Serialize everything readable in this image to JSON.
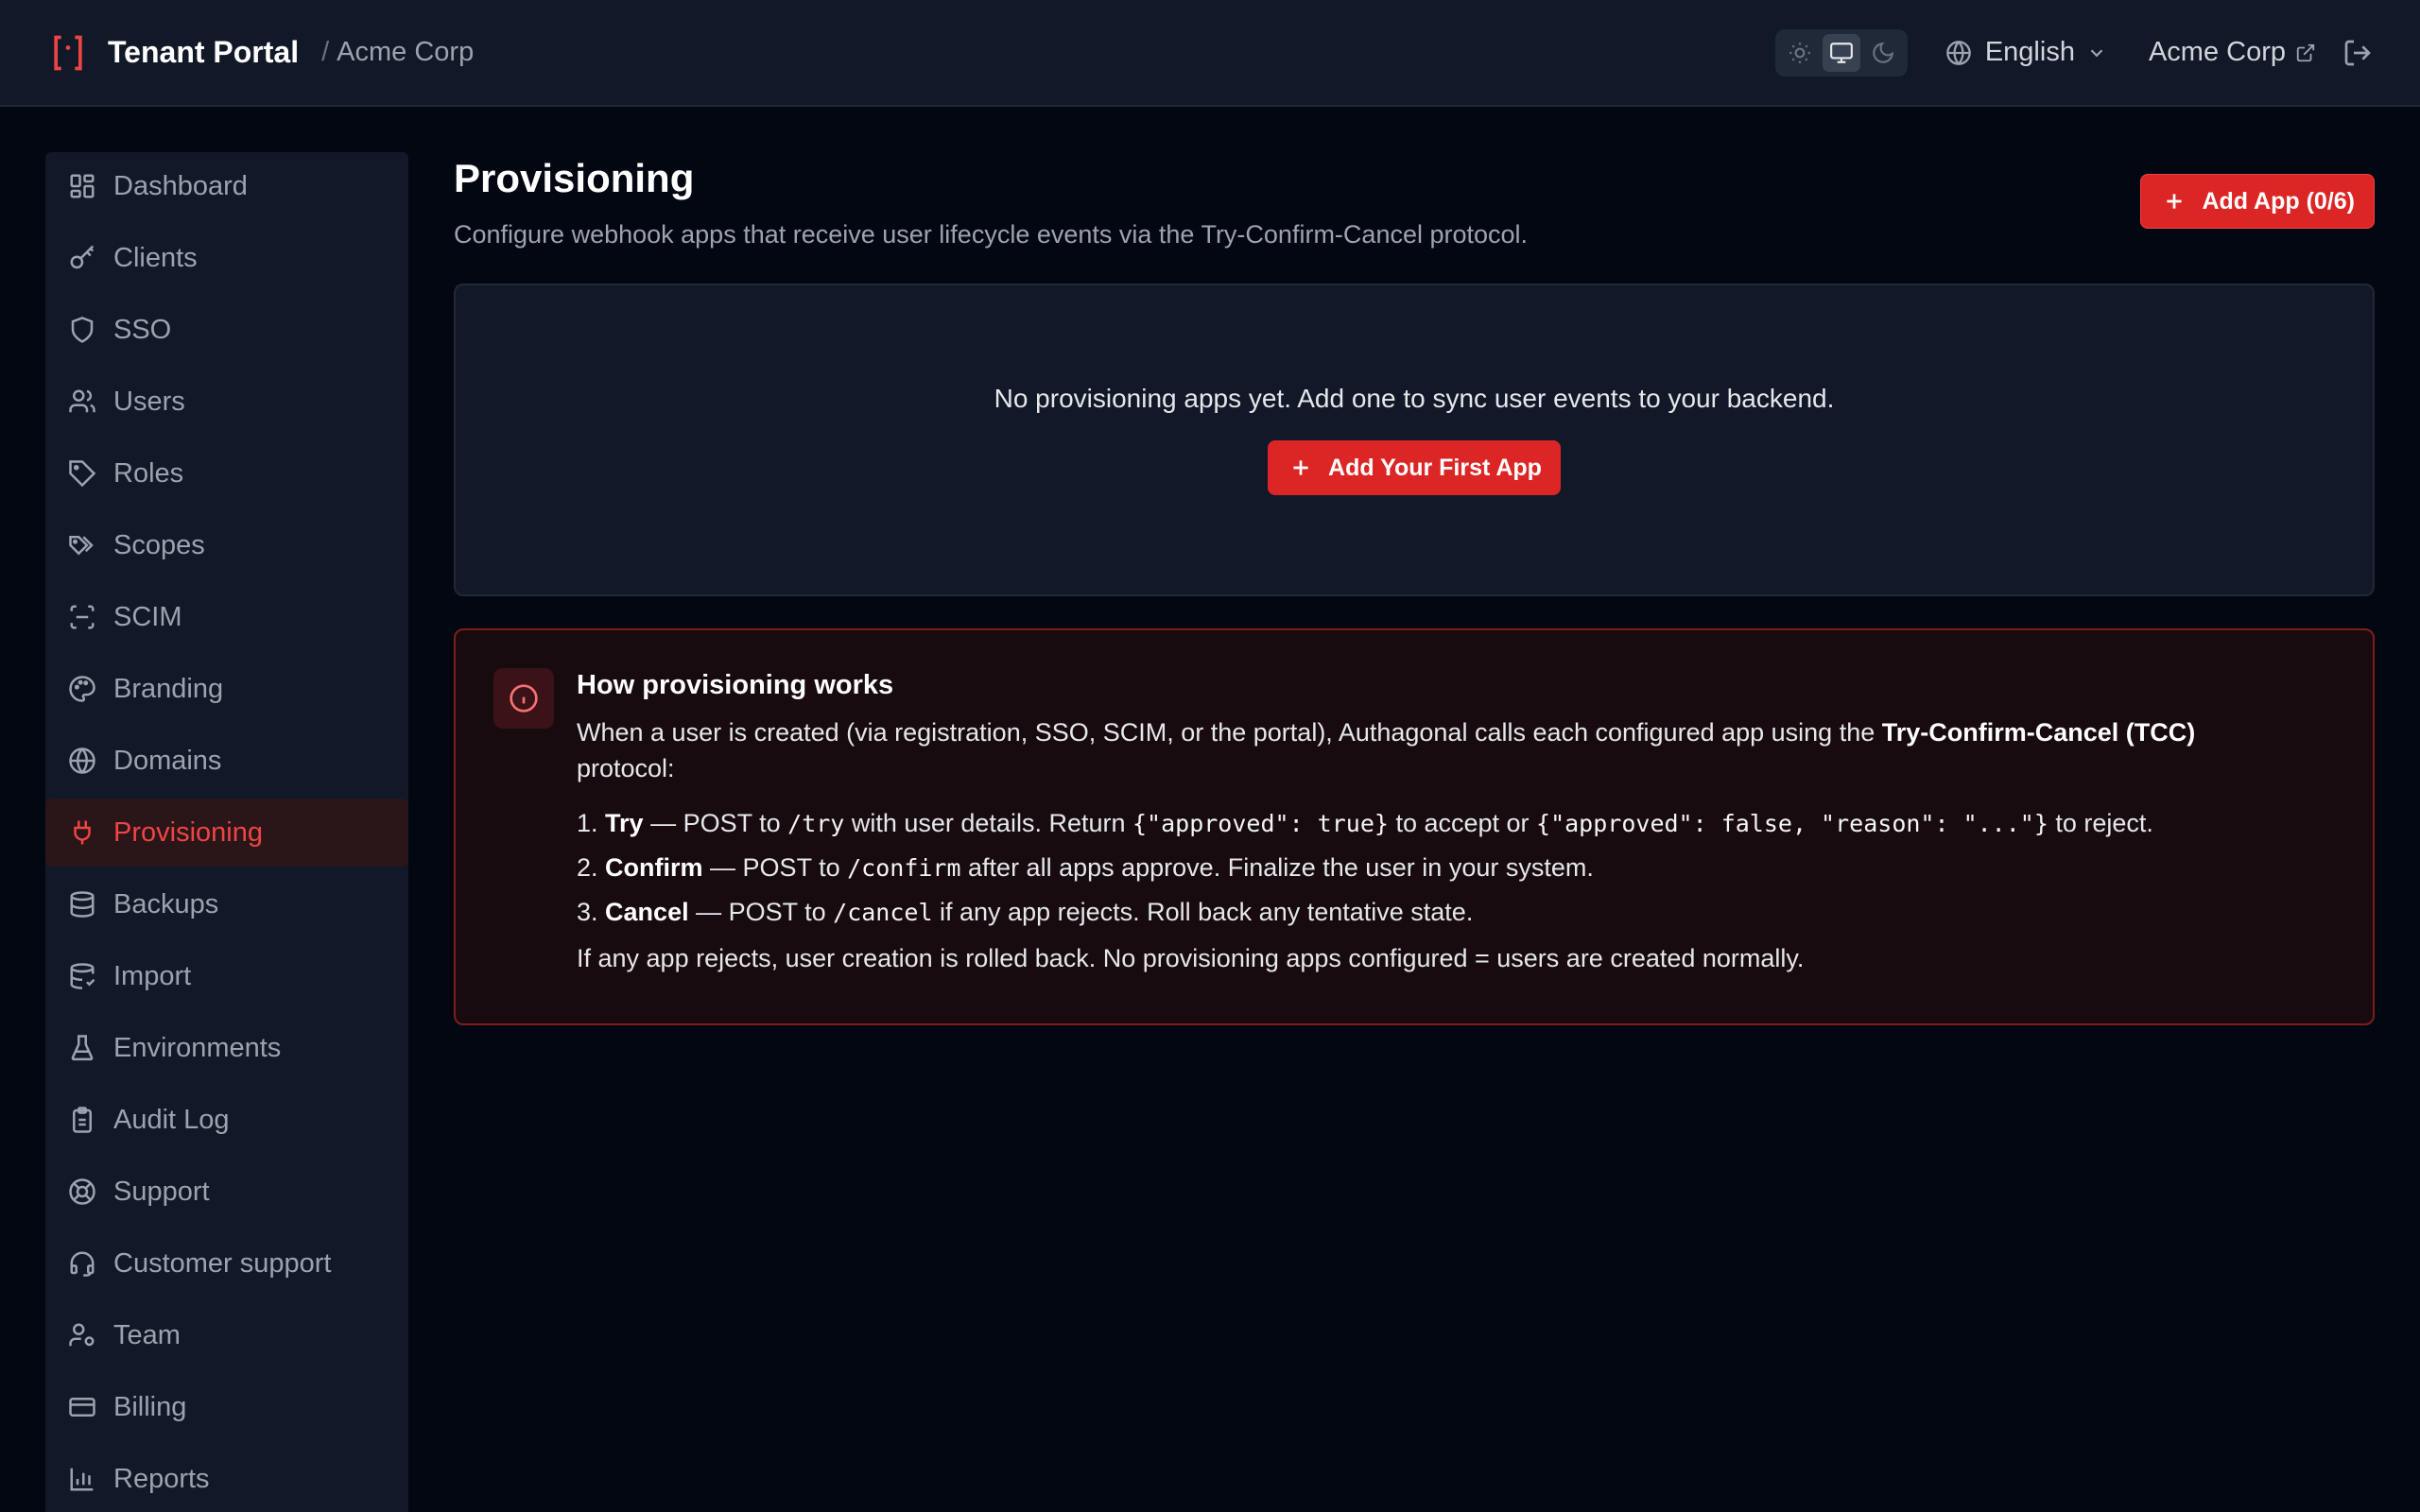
{
  "header": {
    "app_title": "Tenant Portal",
    "breadcrumb_sep": "/",
    "breadcrumb": "Acme Corp",
    "theme_options": [
      "light",
      "system",
      "dark"
    ],
    "theme_selected": "system",
    "language": "English",
    "tenant_link": "Acme Corp",
    "accent_color": "#ef4444"
  },
  "sidebar": {
    "items": [
      {
        "label": "Dashboard",
        "icon": "dashboard-icon"
      },
      {
        "label": "Clients",
        "icon": "key-icon"
      },
      {
        "label": "SSO",
        "icon": "shield-icon"
      },
      {
        "label": "Users",
        "icon": "users-icon"
      },
      {
        "label": "Roles",
        "icon": "tag-icon"
      },
      {
        "label": "Scopes",
        "icon": "tags-icon"
      },
      {
        "label": "SCIM",
        "icon": "scan-icon"
      },
      {
        "label": "Branding",
        "icon": "palette-icon"
      },
      {
        "label": "Domains",
        "icon": "globe-icon"
      },
      {
        "label": "Provisioning",
        "icon": "plug-icon",
        "active": true
      },
      {
        "label": "Backups",
        "icon": "database-icon"
      },
      {
        "label": "Import",
        "icon": "database-import-icon"
      },
      {
        "label": "Environments",
        "icon": "flask-icon"
      },
      {
        "label": "Audit Log",
        "icon": "clipboard-icon"
      },
      {
        "label": "Support",
        "icon": "lifebuoy-icon"
      },
      {
        "label": "Customer support",
        "icon": "headset-icon"
      },
      {
        "label": "Team",
        "icon": "user-cog-icon"
      },
      {
        "label": "Billing",
        "icon": "credit-card-icon"
      },
      {
        "label": "Reports",
        "icon": "bar-chart-icon"
      }
    ]
  },
  "main": {
    "title": "Provisioning",
    "subtitle": "Configure webhook apps that receive user lifecycle events via the Try-Confirm-Cancel protocol.",
    "add_app_label": "Add App (0/6)",
    "empty_text": "No provisioning apps yet. Add one to sync user events to your backend.",
    "add_first_label": "Add Your First App",
    "info": {
      "title": "How provisioning works",
      "para_start": "When a user is created (via registration, SSO, SCIM, or the portal), Authagonal calls each configured app using the ",
      "para_bold": "Try-Confirm-Cancel (TCC)",
      "para_end": "protocol:",
      "steps": [
        {
          "num": "1.",
          "name": "Try",
          "pre": " — POST to ",
          "code": "/try",
          "post": " with user details. Return ",
          "code2": "{\"approved\": true}",
          "mid": " to accept or ",
          "code3": "{\"approved\": false, \"reason\": \"...\"}",
          "end": " to reject."
        },
        {
          "num": "2.",
          "name": "Confirm",
          "pre": " — POST to ",
          "code": "/confirm",
          "post": " after all apps approve. Finalize the user in your system."
        },
        {
          "num": "3.",
          "name": "Cancel",
          "pre": " — POST to ",
          "code": "/cancel",
          "post": " if any app rejects. Roll back any tentative state."
        }
      ],
      "footer": "If any app rejects, user creation is rolled back. No provisioning apps configured = users are created normally."
    }
  }
}
